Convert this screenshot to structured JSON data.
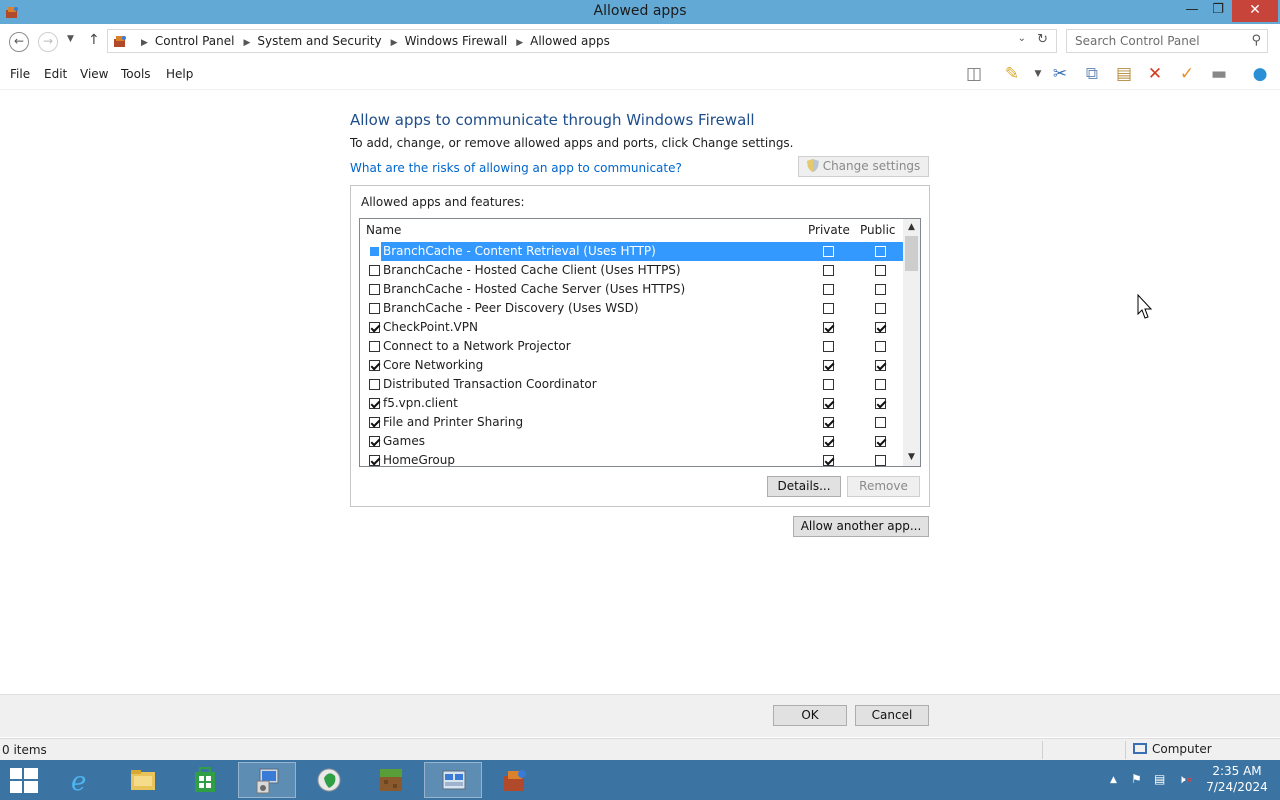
{
  "window": {
    "title": "Allowed apps"
  },
  "address": {
    "crumbs": [
      "Control Panel",
      "System and Security",
      "Windows Firewall",
      "Allowed apps"
    ],
    "search_placeholder": "Search Control Panel"
  },
  "menu": [
    "File",
    "Edit",
    "View",
    "Tools",
    "Help"
  ],
  "page": {
    "title": "Allow apps to communicate through Windows Firewall",
    "description": "To add, change, or remove allowed apps and ports, click Change settings.",
    "risks_link": "What are the risks of allowing an app to communicate?",
    "change_settings": "Change settings",
    "group_label": "Allowed apps and features:",
    "columns": {
      "name": "Name",
      "private": "Private",
      "public": "Public"
    },
    "rows": [
      {
        "name": "BranchCache - Content Retrieval (Uses HTTP)",
        "enabled": false,
        "private": false,
        "public": false,
        "selected": true
      },
      {
        "name": "BranchCache - Hosted Cache Client (Uses HTTPS)",
        "enabled": false,
        "private": false,
        "public": false
      },
      {
        "name": "BranchCache - Hosted Cache Server (Uses HTTPS)",
        "enabled": false,
        "private": false,
        "public": false
      },
      {
        "name": "BranchCache - Peer Discovery (Uses WSD)",
        "enabled": false,
        "private": false,
        "public": false
      },
      {
        "name": "CheckPoint.VPN",
        "enabled": true,
        "private": true,
        "public": true
      },
      {
        "name": "Connect to a Network Projector",
        "enabled": false,
        "private": false,
        "public": false
      },
      {
        "name": "Core Networking",
        "enabled": true,
        "private": true,
        "public": true
      },
      {
        "name": "Distributed Transaction Coordinator",
        "enabled": false,
        "private": false,
        "public": false
      },
      {
        "name": "f5.vpn.client",
        "enabled": true,
        "private": true,
        "public": true
      },
      {
        "name": "File and Printer Sharing",
        "enabled": true,
        "private": true,
        "public": false
      },
      {
        "name": "Games",
        "enabled": true,
        "private": true,
        "public": true
      },
      {
        "name": "HomeGroup",
        "enabled": true,
        "private": true,
        "public": false
      }
    ],
    "details_button": "Details...",
    "remove_button": "Remove",
    "allow_another_button": "Allow another app..."
  },
  "dialog": {
    "ok": "OK",
    "cancel": "Cancel"
  },
  "status": {
    "items": "0 items",
    "zone": "Computer"
  },
  "taskbar": {
    "time": "2:35 AM",
    "date": "7/24/2024"
  },
  "colors": {
    "titlebar": "#62a9d6",
    "close": "#c7443a",
    "taskbar": "#3b74a3",
    "selection": "#3399ff",
    "link": "#0066cc",
    "heading": "#1e4e8c"
  }
}
